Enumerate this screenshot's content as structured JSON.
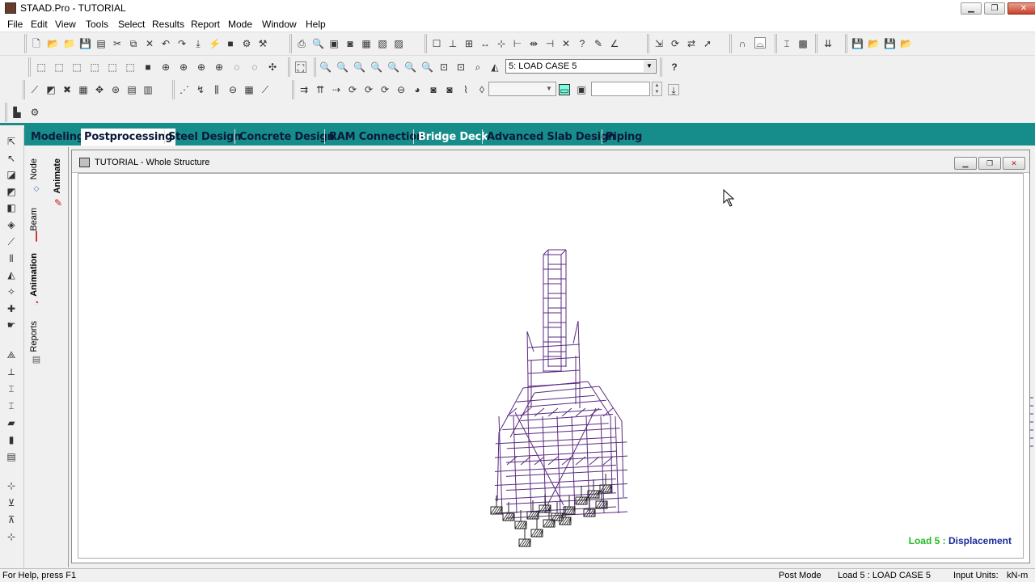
{
  "window": {
    "title": "STAAD.Pro - TUTORIAL",
    "minimize": "▁",
    "maximize": "❐",
    "close": "✕"
  },
  "menu": [
    "File",
    "Edit",
    "View",
    "Tools",
    "Select",
    "Results",
    "Report",
    "Mode",
    "Window",
    "Help"
  ],
  "toolbar": {
    "load_case_value": "5: LOAD CASE 5",
    "help_icon": "?"
  },
  "mode_tabs": [
    {
      "label": "Modeling",
      "active": false
    },
    {
      "label": "Postprocessing",
      "active": true
    },
    {
      "label": "Steel Design",
      "active": false
    },
    {
      "label": "Concrete Design",
      "active": false
    },
    {
      "label": "RAM Connection",
      "active": false
    },
    {
      "label": "Bridge Deck",
      "active": false
    },
    {
      "label": "Advanced Slab Design",
      "active": false
    },
    {
      "label": "Piping",
      "active": false
    }
  ],
  "side_tabs": [
    "Node",
    "Beam",
    "Animation",
    "Reports"
  ],
  "sub_tab": "Animate",
  "viewport": {
    "title": "TUTORIAL - Whole Structure",
    "caption_load": "Load 5 :",
    "caption_type": "Displacement",
    "caption_load_color": "#22bb22",
    "caption_type_color": "#1a2a9a"
  },
  "status": {
    "help": "For Help, press F1",
    "mode": "Post Mode",
    "load": "Load 5 : LOAD CASE 5",
    "units_label": "Input Units:",
    "units_value": "kN-m"
  }
}
